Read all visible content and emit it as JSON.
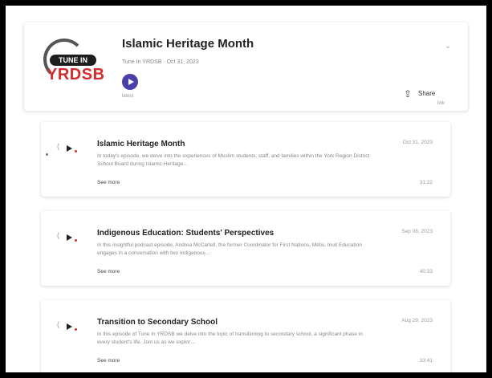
{
  "header": {
    "logo": {
      "tag": "TUNE IN",
      "brand": "YRDSB"
    },
    "title": "Islamic Heritage Month",
    "subtitle": "Tune In YRDSB · Oct 31, 2023",
    "play_label": "latest",
    "share_label": "Share",
    "share_note": "link"
  },
  "episodes": [
    {
      "title": "Islamic Heritage Month",
      "description": "In today's episode, we delve into the experiences of Muslim students, staff, and families within the York Region District School Board during Islamic Heritage…",
      "see_more": "See more",
      "date": "Oct 31, 2023",
      "duration": "31:22"
    },
    {
      "title": "Indigenous Education: Students' Perspectives",
      "description": "In this insightful podcast episode, Andrea McCartell, the former Coordinator for First Nations, Métis, Inuit Education engages in a conversation with two Indigenous…",
      "see_more": "See more",
      "date": "Sep 08, 2023",
      "duration": "40:33"
    },
    {
      "title": "Transition to Secondary School",
      "description": "In this episode of Tune In YRDSB we delve into the topic of transitioning to secondary school, a significant phase in every student's life. Join us as we explor…",
      "see_more": "See more",
      "date": "Aug 29, 2023",
      "duration": "33:41"
    }
  ],
  "colors": {
    "brand_red": "#d62b2b",
    "play_purple": "#4a3fa8"
  }
}
